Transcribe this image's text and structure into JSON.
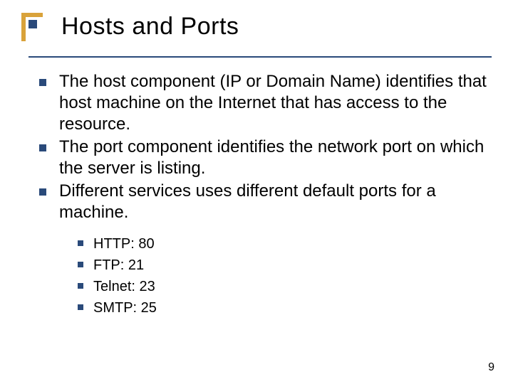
{
  "title": "Hosts and Ports",
  "bullets": [
    "The host component (IP or Domain Name) identifies that host machine on the Internet that has access to the resource.",
    "The port component identifies the network port on which the server is listing.",
    "Different services uses different default ports for a machine."
  ],
  "sub_bullets": [
    "HTTP: 80",
    "FTP: 21",
    "Telnet: 23",
    "SMTP: 25"
  ],
  "page_number": "9"
}
